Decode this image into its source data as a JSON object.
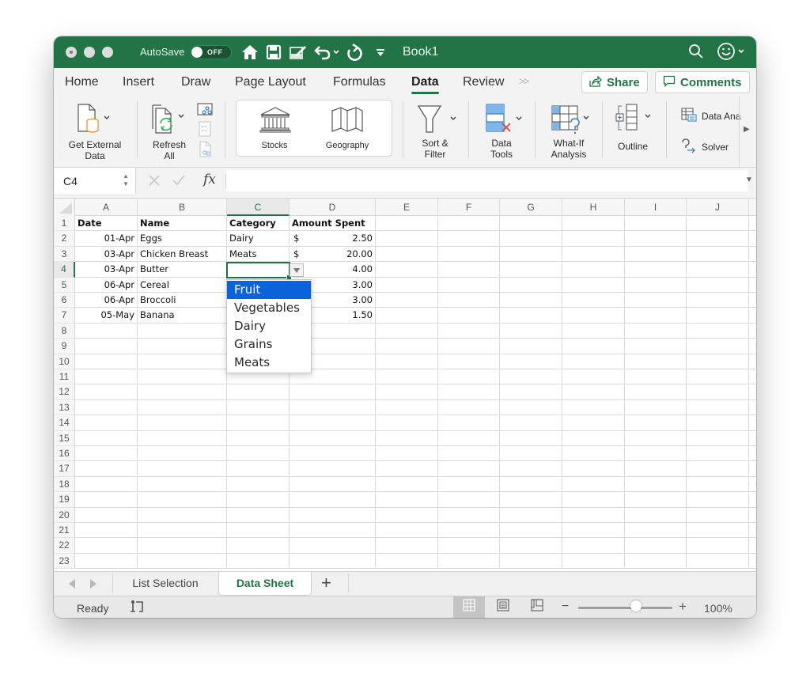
{
  "window": {
    "title": "Book1",
    "autosave_label": "AutoSave",
    "autosave_state": "OFF",
    "accent_color": "#227447"
  },
  "titlebar_icons": [
    "home-icon",
    "save-icon",
    "edit-document-icon",
    "undo-icon",
    "chevron-down-icon",
    "redo-icon",
    "customize-toolbar-icon",
    "search-icon",
    "smiley-feedback-icon"
  ],
  "ribbon_tabs": [
    {
      "label": "Home",
      "active": false
    },
    {
      "label": "Insert",
      "active": false
    },
    {
      "label": "Draw",
      "active": false
    },
    {
      "label": "Page Layout",
      "active": false
    },
    {
      "label": "Formulas",
      "active": false
    },
    {
      "label": "Data",
      "active": true
    },
    {
      "label": "Review",
      "active": false
    }
  ],
  "header_buttons": {
    "share": "Share",
    "comments": "Comments"
  },
  "ribbon": {
    "get_external_data": "Get External Data",
    "get_external_data_l1": "Get External",
    "get_external_data_l2": "Data",
    "refresh_all_l1": "Refresh",
    "refresh_all_l2": "All",
    "stocks": "Stocks",
    "geography": "Geography",
    "sort_filter_l1": "Sort &",
    "sort_filter_l2": "Filter",
    "data_tools_l1": "Data",
    "data_tools_l2": "Tools",
    "what_if_l1": "What-If",
    "what_if_l2": "Analysis",
    "outline": "Outline",
    "data_analysis": "Data Ana",
    "solver": "Solver"
  },
  "formula_bar": {
    "name_box": "C4",
    "fx_label": "fx",
    "formula_value": ""
  },
  "grid": {
    "columns": [
      "A",
      "B",
      "C",
      "D",
      "E",
      "F",
      "G",
      "H",
      "I",
      "J"
    ],
    "selected_column": "C",
    "selected_row": 4,
    "row_numbers": [
      1,
      2,
      3,
      4,
      5,
      6,
      7,
      8,
      9,
      10,
      11,
      12,
      13,
      14,
      15,
      16,
      17,
      18,
      19,
      20,
      21,
      22,
      23
    ],
    "headers": {
      "A": "Date",
      "B": "Name",
      "C": "Category",
      "D": "Amount Spent"
    },
    "rows": [
      {
        "date": "01-Apr",
        "name": "Eggs",
        "category": "Dairy",
        "currency": "$",
        "amount": "2.50"
      },
      {
        "date": "03-Apr",
        "name": "Chicken Breast",
        "category": "Meats",
        "currency": "$",
        "amount": "20.00"
      },
      {
        "date": "03-Apr",
        "name": "Butter",
        "category": "",
        "currency": "",
        "amount": "4.00"
      },
      {
        "date": "06-Apr",
        "name": "Cereal",
        "category": "",
        "currency": "",
        "amount": "3.00"
      },
      {
        "date": "06-Apr",
        "name": "Broccoli",
        "category": "",
        "currency": "",
        "amount": "3.00"
      },
      {
        "date": "05-May",
        "name": "Banana",
        "category": "",
        "currency": "",
        "amount": "1.50"
      }
    ]
  },
  "dropdown": {
    "options": [
      "Fruit",
      "Vegetables",
      "Dairy",
      "Grains",
      "Meats"
    ],
    "highlighted": "Fruit",
    "highlight_color": "#0a63d9"
  },
  "sheets": {
    "tabs": [
      {
        "label": "List Selection",
        "active": false
      },
      {
        "label": "Data Sheet",
        "active": true
      }
    ],
    "add_label": "+"
  },
  "status": {
    "text": "Ready",
    "zoom_minus": "−",
    "zoom_plus": "+",
    "zoom_percent": "100%",
    "zoom_level": 1.0
  }
}
